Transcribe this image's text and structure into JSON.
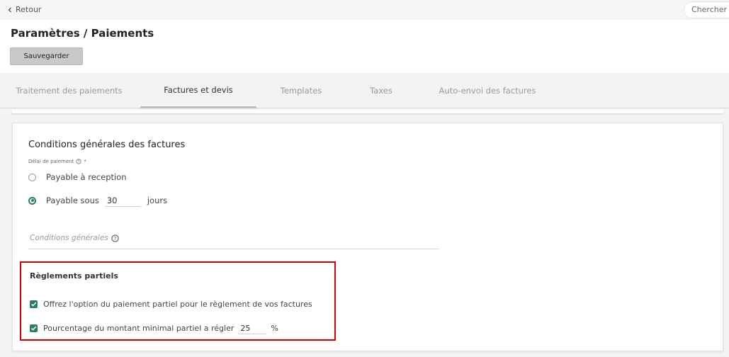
{
  "topbar": {
    "back_label": "Retour",
    "search_label": "Chercher"
  },
  "header": {
    "title": "Paramètres / Paiements",
    "save_label": "Sauvegarder"
  },
  "tabs": [
    {
      "label": "Traitement des paiements",
      "active": false
    },
    {
      "label": "Factures et devis",
      "active": true
    },
    {
      "label": "Templates",
      "active": false
    },
    {
      "label": "Taxes",
      "active": false
    },
    {
      "label": "Auto-envoi des factures",
      "active": false
    }
  ],
  "terms": {
    "title": "Conditions générales des factures",
    "delay_label": "Délai de paiement",
    "required_mark": "*",
    "options": [
      {
        "label": "Payable à reception",
        "selected": false
      },
      {
        "label": "Payable sous",
        "selected": true,
        "days_value": "30",
        "days_unit": "jours"
      }
    ],
    "conditions_label": "Conditions générales"
  },
  "partial": {
    "title": "Règlements partiels",
    "option_label": "Offrez l'option du paiement partiel pour le règlement de vos factures",
    "option_checked": true,
    "percent_label": "Pourcentage du montant minimal partiel a régler",
    "percent_checked": true,
    "percent_value": "25",
    "percent_unit": "%"
  },
  "colors": {
    "accent_green": "#2e7d5b",
    "highlight_red": "#d40000",
    "button_gray": "#c9c9c9"
  }
}
